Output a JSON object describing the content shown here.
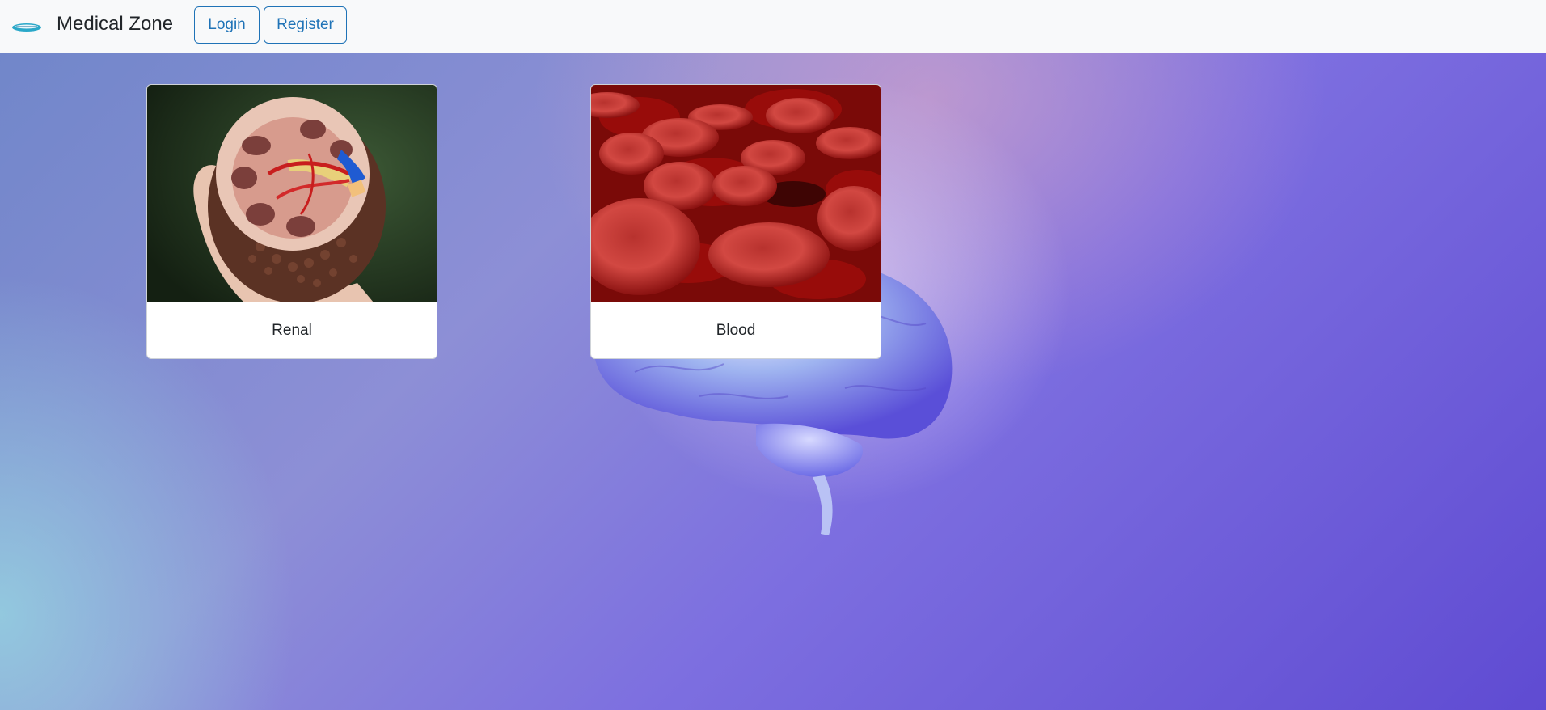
{
  "header": {
    "brand": "Medical Zone",
    "logo_icon": "logo-icon",
    "login_label": "Login",
    "register_label": "Register"
  },
  "cards": [
    {
      "title": "Renal",
      "image": "kidney-model-photo"
    },
    {
      "title": "Blood",
      "image": "red-blood-cells-photo"
    }
  ],
  "background": {
    "image": "brain-illustration",
    "accent": "#5f4bd2"
  },
  "colors": {
    "button": "#1f73b7",
    "navbar": "#f8f9fa"
  }
}
